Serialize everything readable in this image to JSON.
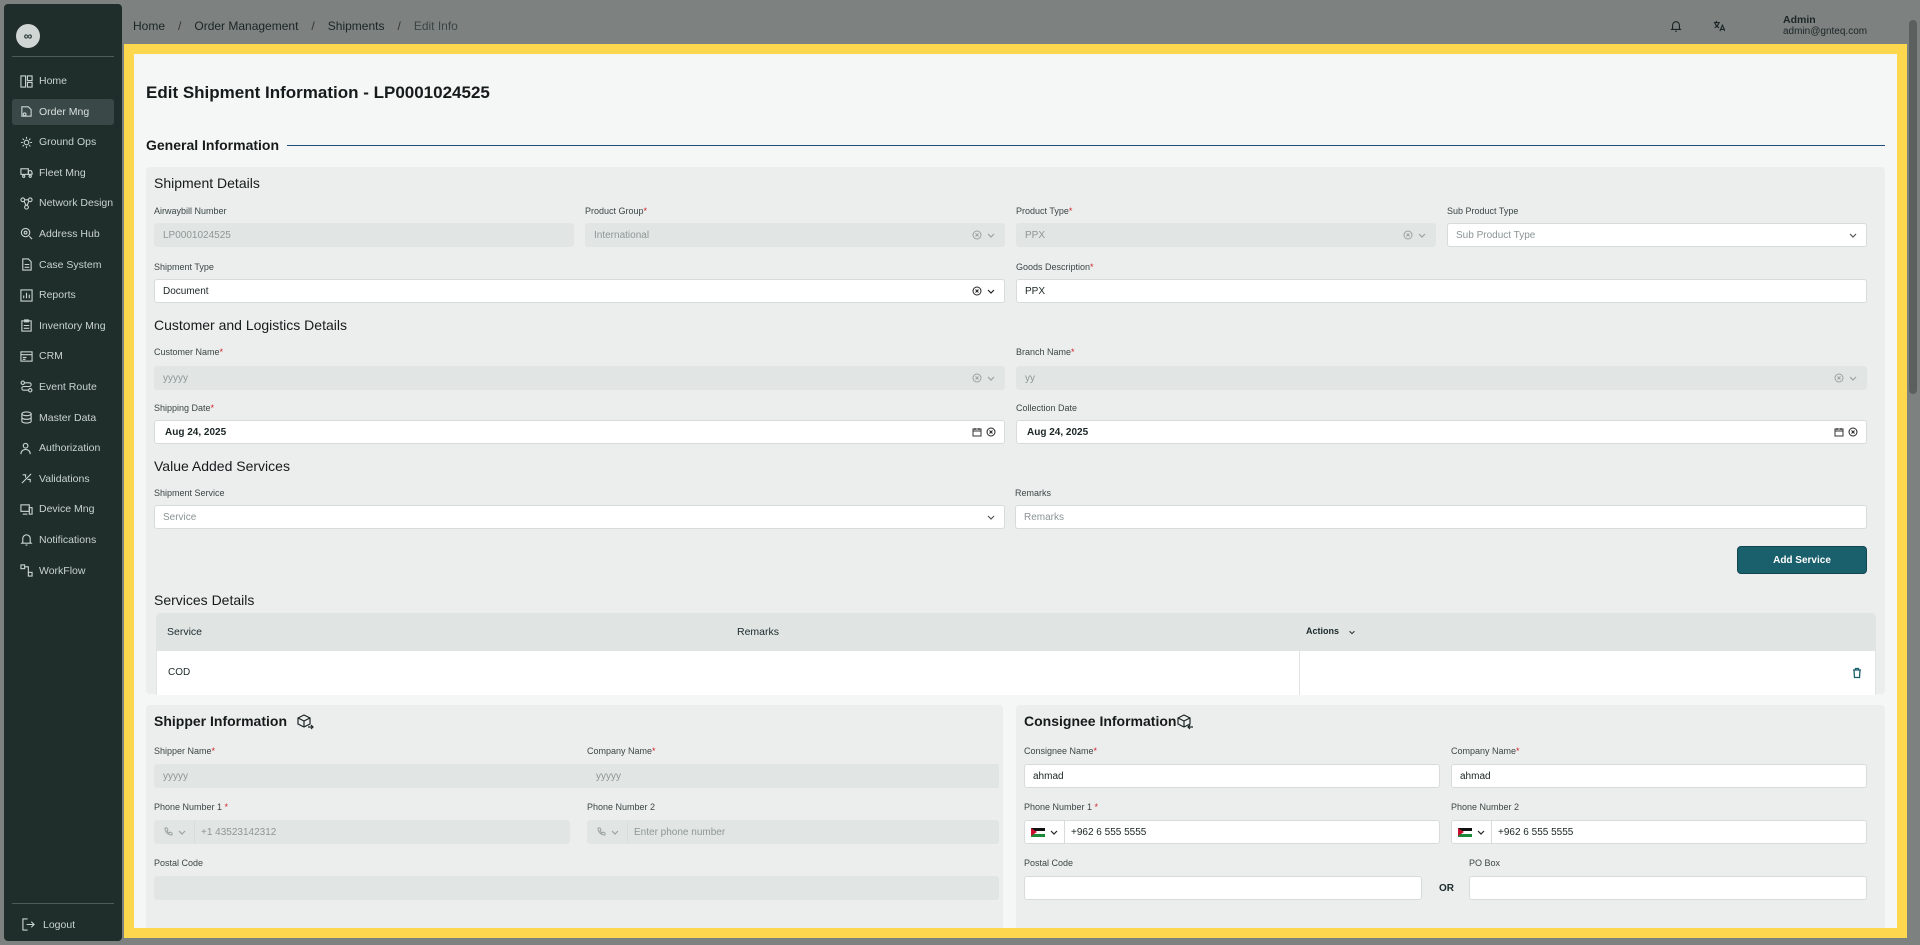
{
  "sidebar": {
    "logo": "∞",
    "items": [
      {
        "label": "Home",
        "icon": "layout-icon"
      },
      {
        "label": "Order Mng",
        "icon": "order-icon"
      },
      {
        "label": "Ground Ops",
        "icon": "gear-icon"
      },
      {
        "label": "Fleet Mng",
        "icon": "truck-icon"
      },
      {
        "label": "Network Design",
        "icon": "network-icon"
      },
      {
        "label": "Address Hub",
        "icon": "map-pin-icon"
      },
      {
        "label": "Case System",
        "icon": "file-icon"
      },
      {
        "label": "Reports",
        "icon": "chart-icon"
      },
      {
        "label": "Inventory Mng",
        "icon": "clipboard-icon"
      },
      {
        "label": "CRM",
        "icon": "id-card-icon"
      },
      {
        "label": "Event Route",
        "icon": "route-icon"
      },
      {
        "label": "Master Data",
        "icon": "database-icon"
      },
      {
        "label": "Authorization",
        "icon": "user-icon"
      },
      {
        "label": "Validations",
        "icon": "check-icon"
      },
      {
        "label": "Device Mng",
        "icon": "device-icon"
      },
      {
        "label": "Notifications",
        "icon": "bell-icon"
      },
      {
        "label": "WorkFlow",
        "icon": "workflow-icon"
      }
    ],
    "logout": "Logout"
  },
  "header": {
    "breadcrumb": [
      "Home",
      "Order Management",
      "Shipments",
      "Edit Info"
    ],
    "separator": "/",
    "user_name": "Admin",
    "user_email": "admin@gnteq.com"
  },
  "page": {
    "title": "Edit Shipment Information - LP0001024525",
    "general_info": "General Information"
  },
  "shipment_details": {
    "title": "Shipment Details",
    "awb_label": "Airwaybill Number",
    "awb_value": "LP0001024525",
    "product_group_label": "Product Group",
    "product_group_value": "International",
    "product_type_label": "Product Type",
    "product_type_value": "PPX",
    "sub_product_label": "Sub Product Type",
    "sub_product_placeholder": "Sub Product Type",
    "shipment_type_label": "Shipment Type",
    "shipment_type_value": "Document",
    "goods_desc_label": "Goods Description",
    "goods_desc_value": "PPX"
  },
  "customer": {
    "title": "Customer and Logistics Details",
    "customer_name_label": "Customer Name",
    "customer_name_value": "yyyyy",
    "branch_name_label": "Branch Name",
    "branch_name_value": "yy",
    "shipping_date_label": "Shipping Date",
    "shipping_date_value": "Aug 24, 2025",
    "collection_date_label": "Collection Date",
    "collection_date_value": "Aug 24, 2025"
  },
  "vas": {
    "title": "Value Added Services",
    "service_label": "Shipment Service",
    "service_placeholder": "Service",
    "remarks_label": "Remarks",
    "remarks_placeholder": "Remarks",
    "add_button": "Add Service"
  },
  "services_details": {
    "title": "Services Details",
    "columns": {
      "service": "Service",
      "remarks": "Remarks",
      "actions": "Actions"
    },
    "rows": [
      {
        "service": "COD",
        "remarks": ""
      }
    ]
  },
  "shipper": {
    "title": "Shipper Information",
    "name_label": "Shipper Name",
    "name_value": "yyyyy",
    "company_label": "Company Name",
    "company_value": "yyyyy",
    "phone1_label": "Phone Number 1",
    "phone1_value": "+1 43523142312",
    "phone2_label": "Phone Number 2",
    "phone2_placeholder": "Enter phone number",
    "postal_label": "Postal Code"
  },
  "consignee": {
    "title": "Consignee Information",
    "name_label": "Consignee Name",
    "name_value": "ahmad",
    "company_label": "Company Name",
    "company_value": "ahmad",
    "phone1_label": "Phone Number 1",
    "phone1_value": "+962 6 555 5555",
    "phone2_label": "Phone Number 2",
    "phone2_value": "+962 6 555 5555",
    "postal_label": "Postal Code",
    "or_text": "OR",
    "pobox_label": "PO Box"
  },
  "colors": {
    "accent": "#1a5f6c",
    "frame": "#fdd84e",
    "sidebar": "#1f2d2b",
    "required": "#d0232b"
  }
}
